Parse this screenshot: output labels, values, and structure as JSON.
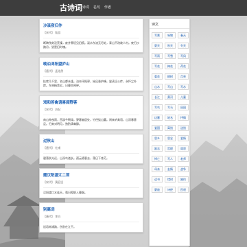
{
  "header": {
    "brand": "古诗词",
    "nav": [
      "诗词",
      "名句",
      "作者"
    ]
  },
  "posts": [
    {
      "title": "沙溪夜归作",
      "meta": "【宋代】 陆游",
      "body": "断碑残刻没荒榛，废井颓垣见旧痕。溪水东流无尽处，青山不改故人村。夜归沙路月，犹是旧时魂。"
    },
    {
      "title": "晚泊浔阳望庐山",
      "meta": "【唐代】 孟浩然",
      "body": "挂席几千里，名山都未逢。泊舟浔阳郭，始见香炉峰。尝读远公传，永怀尘外踪。东林精舍近，日暮空闻钟。"
    },
    {
      "title": "戏和答禽语喜闻野客",
      "meta": "【宋代】 苏轼",
      "body": "南山昨夜雨，西溪今朝渌。野客幽居处，竹径绕山麓。闲来听禽语，山深春意足。归来对明月，独酌清尊醁。"
    },
    {
      "title": "过秋山",
      "meta": "【唐代】 杜甫",
      "body": "碧落秋光远，山深鸟道长。孤云随客去，落日下苍茫。"
    },
    {
      "title": "题汉阳渡江二首",
      "meta": "【宋代】 黄庭坚",
      "body": "汉阳渡口水连天，落日孤帆入暮烟。"
    },
    {
      "title": "别离词",
      "meta": "【唐代】 李白",
      "body": "送君南浦路，伤别在江干。"
    }
  ],
  "sidebar": {
    "heading": "诗文",
    "tags": [
      "写景",
      "咏物",
      "春天",
      "夏天",
      "秋天",
      "冬天",
      "写雨",
      "写雪",
      "写风",
      "写花",
      "梅花",
      "荷花",
      "菊花",
      "柳树",
      "月亮",
      "山水",
      "写山",
      "写水",
      "长江",
      "黄河",
      "儿童",
      "写鸟",
      "写马",
      "田园",
      "边塞",
      "地名",
      "抒情",
      "爱国",
      "离别",
      "送别",
      "思乡",
      "思念",
      "爱情",
      "励志",
      "哲理",
      "闺怨",
      "悼亡",
      "写人",
      "老师",
      "母亲",
      "友情",
      "战争",
      "读书",
      "惜时",
      "婉约",
      "豪放",
      "诗经",
      "民谣"
    ]
  }
}
